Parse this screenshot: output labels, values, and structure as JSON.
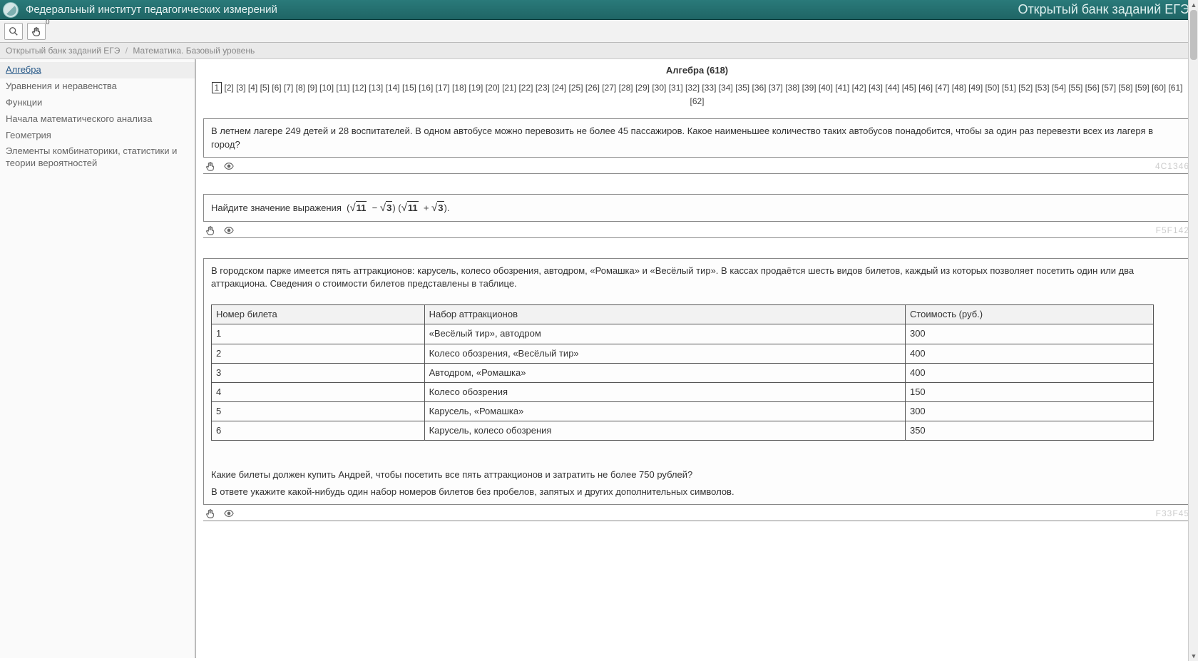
{
  "header": {
    "site_title": "Федеральный институт педагогических измерений",
    "bank_title": "Открытый банк заданий ЕГЭ"
  },
  "toolbar": {
    "badge": "0"
  },
  "breadcrumb": {
    "root": "Открытый банк заданий ЕГЭ",
    "leaf": "Математика. Базовый уровень"
  },
  "sidebar": {
    "items": [
      {
        "label": "Алгебра",
        "active": true
      },
      {
        "label": "Уравнения и неравенства"
      },
      {
        "label": "Функции"
      },
      {
        "label": "Начала математического анализа"
      },
      {
        "label": "Геометрия"
      },
      {
        "label": "Элементы комбинаторики, статистики и теории вероятностей"
      }
    ]
  },
  "content": {
    "heading": "Алгебра (618)",
    "page_count": 62,
    "current_page": 1,
    "tasks": [
      {
        "id": "4C1346",
        "text": "В летнем лагере 249 детей и 28 воспитателей. В одном автобусе можно перевозить не более 45 пассажиров. Какое наименьшее количество таких автобусов понадобится, чтобы за один раз перевезти всех из лагеря в город?"
      },
      {
        "id": "F5F142",
        "text_prefix": "Найдите значение выражения",
        "expr": {
          "a": "11",
          "b": "3"
        }
      },
      {
        "id": "F33F45",
        "intro": "В городском парке имеется пять аттракционов: карусель, колесо обозрения, автодром, «Ромашка» и «Весёлый тир». В кассах продаётся шесть видов билетов, каждый из которых позволяет посетить один или два аттракциона. Сведения о стоимости билетов представлены в таблице.",
        "table": {
          "headers": [
            "Номер билета",
            "Набор аттракционов",
            "Стоимость (руб.)"
          ],
          "rows": [
            [
              "1",
              "«Весёлый тир», автодром",
              "300"
            ],
            [
              "2",
              "Колесо обозрения, «Весёлый тир»",
              "400"
            ],
            [
              "3",
              "Автодром, «Ромашка»",
              "400"
            ],
            [
              "4",
              "Колесо обозрения",
              "150"
            ],
            [
              "5",
              "Карусель, «Ромашка»",
              "300"
            ],
            [
              "6",
              "Карусель, колесо обозрения",
              "350"
            ]
          ]
        },
        "q1": "Какие билеты должен купить Андрей, чтобы посетить все пять аттракционов и затратить не более 750 рублей?",
        "q2": "В ответе укажите какой-нибудь один набор номеров билетов без пробелов, запятых и других дополнительных символов."
      }
    ]
  }
}
